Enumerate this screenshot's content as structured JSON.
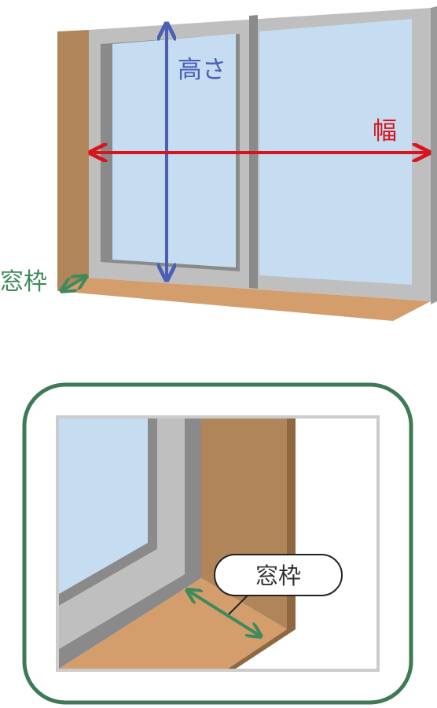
{
  "labels": {
    "height": "高さ",
    "width": "幅",
    "frame": "窓枠",
    "frame_callout": "窓枠"
  },
  "colors": {
    "height_arrow": "#4a5fb5",
    "width_arrow": "#d8141e",
    "frame_arrow": "#3e8a5c",
    "panel_border": "#3e7a56",
    "glass": "#c6dcf1",
    "frame_gray": "#bfbfbf",
    "frame_dark": "#8a8a8a",
    "wood_side": "#b08559",
    "wood_sill": "#d39e6c",
    "wood_dark": "#8f6842"
  }
}
